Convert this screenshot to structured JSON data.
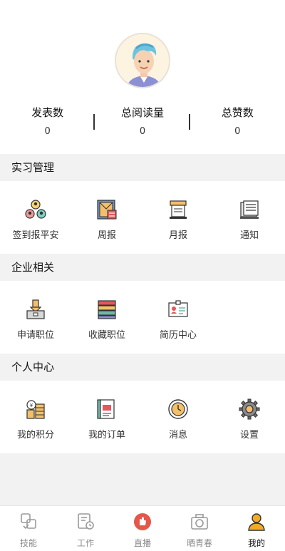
{
  "profile": {
    "stats": [
      {
        "label": "发表数",
        "value": "0"
      },
      {
        "label": "总阅读量",
        "value": "0"
      },
      {
        "label": "总赞数",
        "value": "0"
      }
    ]
  },
  "sections": [
    {
      "title": "实习管理",
      "items": [
        {
          "label": "签到报平安",
          "icon": "group-checkin-icon"
        },
        {
          "label": "周报",
          "icon": "weekly-report-icon"
        },
        {
          "label": "月报",
          "icon": "monthly-report-icon"
        },
        {
          "label": "通知",
          "icon": "notification-icon"
        }
      ]
    },
    {
      "title": "企业相关",
      "items": [
        {
          "label": "申请职位",
          "icon": "apply-job-icon"
        },
        {
          "label": "收藏职位",
          "icon": "favorite-job-icon"
        },
        {
          "label": "简历中心",
          "icon": "resume-icon"
        }
      ]
    },
    {
      "title": "个人中心",
      "items": [
        {
          "label": "我的积分",
          "icon": "points-icon"
        },
        {
          "label": "我的订单",
          "icon": "orders-icon"
        },
        {
          "label": "消息",
          "icon": "message-clock-icon"
        },
        {
          "label": "设置",
          "icon": "settings-gear-icon"
        }
      ]
    }
  ],
  "tabbar": {
    "tabs": [
      {
        "label": "技能",
        "icon": "skills-icon",
        "active": false
      },
      {
        "label": "工作",
        "icon": "work-icon",
        "active": false
      },
      {
        "label": "直播",
        "icon": "live-icon",
        "active": false
      },
      {
        "label": "晒青春",
        "icon": "camera-icon",
        "active": false
      },
      {
        "label": "我的",
        "icon": "profile-user-icon",
        "active": true
      }
    ],
    "active_color": "#111111",
    "inactive_color": "#8a8a8a"
  }
}
